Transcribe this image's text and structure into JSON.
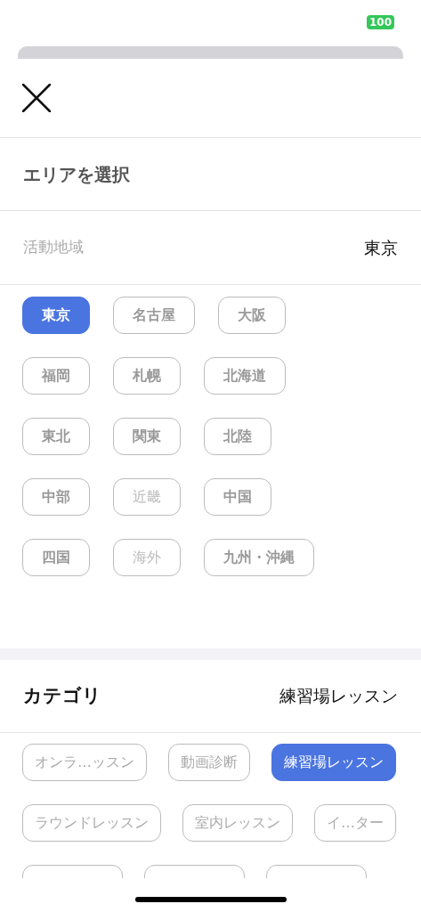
{
  "status_bar": {
    "battery": "100"
  },
  "header": {
    "title": "エリアを選択"
  },
  "area": {
    "label": "活動地域",
    "value": "東京",
    "chips": [
      {
        "label": "東京",
        "selected": true,
        "disabled": false
      },
      {
        "label": "名古屋",
        "selected": false,
        "disabled": false
      },
      {
        "label": "大阪",
        "selected": false,
        "disabled": false
      },
      {
        "label": "福岡",
        "selected": false,
        "disabled": false
      },
      {
        "label": "札幌",
        "selected": false,
        "disabled": false
      },
      {
        "label": "北海道",
        "selected": false,
        "disabled": false
      },
      {
        "label": "東北",
        "selected": false,
        "disabled": false
      },
      {
        "label": "関東",
        "selected": false,
        "disabled": false
      },
      {
        "label": "北陸",
        "selected": false,
        "disabled": false
      },
      {
        "label": "中部",
        "selected": false,
        "disabled": false
      },
      {
        "label": "近畿",
        "selected": false,
        "disabled": true
      },
      {
        "label": "中国",
        "selected": false,
        "disabled": false
      },
      {
        "label": "四国",
        "selected": false,
        "disabled": false
      },
      {
        "label": "海外",
        "selected": false,
        "disabled": true
      },
      {
        "label": "九州・沖縄",
        "selected": false,
        "disabled": false
      }
    ]
  },
  "category": {
    "label": "カテゴリ",
    "value": "練習場レッスン",
    "chips": [
      {
        "kind": "chip",
        "label": "オンラ…ッスン",
        "selected": false
      },
      {
        "kind": "chip",
        "label": "動画診断",
        "selected": false
      },
      {
        "kind": "chip",
        "label": "練習場レッスン",
        "selected": true
      },
      {
        "kind": "chip",
        "label": "ラウンドレッスン",
        "selected": false
      },
      {
        "kind": "chip",
        "label": "室内レッスン",
        "selected": false
      },
      {
        "kind": "chip",
        "label": "イ…ター",
        "selected": false
      },
      {
        "kind": "clipped",
        "selected": false
      },
      {
        "kind": "clipped",
        "selected": false
      },
      {
        "kind": "clipped",
        "selected": false
      }
    ]
  }
}
